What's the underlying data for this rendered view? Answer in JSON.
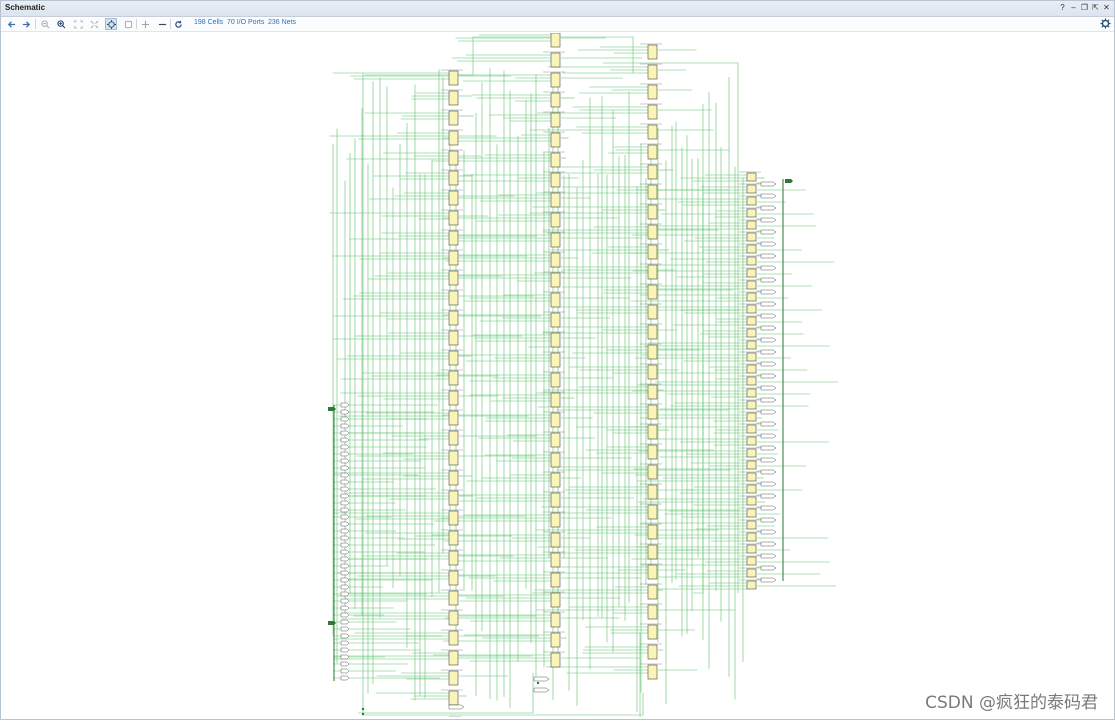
{
  "window": {
    "title": "Schematic",
    "controls": [
      {
        "name": "help-icon",
        "glyph": "?"
      },
      {
        "name": "minimize-icon",
        "glyph": "–"
      },
      {
        "name": "restore-icon",
        "glyph": "❐"
      },
      {
        "name": "float-icon",
        "glyph": "⇱"
      },
      {
        "name": "close-icon",
        "glyph": "✕"
      }
    ]
  },
  "toolbar": {
    "buttons": [
      {
        "name": "back-icon",
        "enabled": true
      },
      {
        "name": "forward-icon",
        "enabled": true
      },
      {
        "name": "zoom-out-icon",
        "enabled": false
      },
      {
        "name": "zoom-in-icon",
        "enabled": true
      },
      {
        "name": "zoom-fit-icon",
        "enabled": false
      },
      {
        "name": "auto-fit-icon",
        "enabled": false
      },
      {
        "name": "fit-selection-icon",
        "enabled": true,
        "active": true
      },
      {
        "name": "regenerate-icon",
        "enabled": false
      },
      {
        "name": "expand-icon",
        "enabled": false
      },
      {
        "name": "collapse-icon",
        "enabled": true
      },
      {
        "name": "reload-icon",
        "enabled": true
      }
    ],
    "stats": {
      "cells": "198 Cells",
      "ports": "70 I/O Ports",
      "nets": "236 Nets"
    }
  },
  "colors": {
    "wire": "#39b54a",
    "cell_fill": "#fbf4b8",
    "cell_stroke": "#4a4a3a",
    "link": "#2a6fc9"
  },
  "watermark": "CSDN @疯狂的泰码君"
}
